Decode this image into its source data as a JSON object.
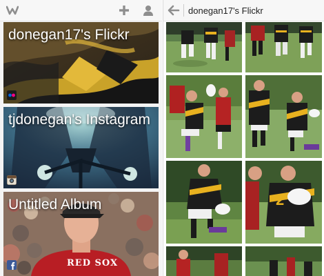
{
  "left_header": {
    "logo_icon": "app-logo-icon",
    "add_icon": "plus-icon",
    "profile_icon": "person-icon"
  },
  "albums": [
    {
      "title": "donegan17's Flickr",
      "source_icon": "flickr-icon"
    },
    {
      "title": "tjdonegan's Instagram",
      "source_icon": "instagram-icon"
    },
    {
      "title": "Untitled Album",
      "source_icon": "facebook-icon",
      "shirt_text": "RED SOX"
    }
  ],
  "right_header": {
    "back_icon": "back-arrow-icon",
    "title": "donegan17's Flickr"
  },
  "photos": [
    {
      "jersey_number": ""
    },
    {
      "jersey_number": ""
    },
    {
      "jersey_number": ""
    },
    {
      "jersey_number": ""
    },
    {
      "jersey_number": ""
    },
    {
      "jersey_number": "2"
    },
    {
      "jersey_number": ""
    },
    {
      "jersey_number": ""
    }
  ],
  "colors": {
    "accent_gray": "#8e8e8e",
    "flickr_blue": "#0063dc",
    "flickr_pink": "#ff0084",
    "facebook_blue": "#3b5998",
    "jersey_gold": "#e8b11f",
    "jersey_black": "#1b1b1b"
  }
}
